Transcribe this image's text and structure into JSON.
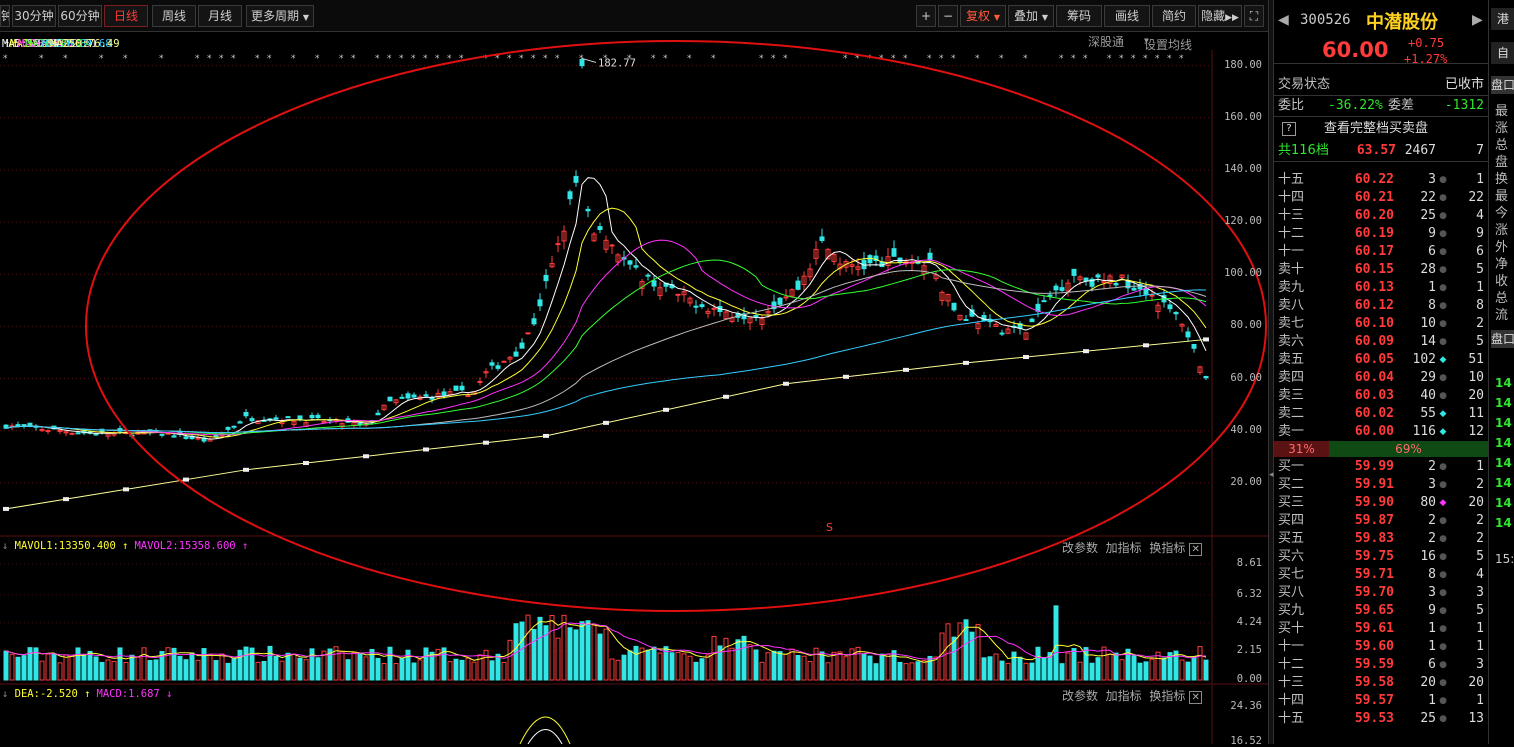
{
  "toolbar": {
    "left_partial": "钟",
    "periods": [
      "30分钟",
      "60分钟",
      "日线",
      "周线",
      "月线",
      "更多周期"
    ],
    "active_period": "日线",
    "zoom_in": "+",
    "zoom_out": "−",
    "right_buttons": [
      "复权",
      "叠加",
      "筹码",
      "画线",
      "简约",
      "隐藏"
    ],
    "expand_icon": "⛶"
  },
  "ma_legend": [
    {
      "text": "MA5:59.84",
      "arrow": "↑",
      "color": "#ffffff"
    },
    {
      "text": "MA10:59.68",
      "arrow": "↑",
      "color": "#ffff33"
    },
    {
      "text": "MA20:59.26",
      "arrow": "↑",
      "color": "#ff33ff"
    },
    {
      "text": "MA30:59.07",
      "arrow": "↑",
      "color": "#33ff33"
    },
    {
      "text": "MA60:72.51",
      "arrow": "↓",
      "color": "#cccccc"
    },
    {
      "text": "MA120:84.68",
      "arrow": "↓",
      "color": "#33ccff"
    },
    {
      "text": "MA250:76.49",
      "arrow": "↑",
      "color": "#ffff88"
    }
  ],
  "chart_links": {
    "shengutong": "深股通",
    "set_ma": "设置均线"
  },
  "peak_label": "182.77",
  "s_marker": "S",
  "price_axis": [
    "180.00",
    "160.00",
    "140.00",
    "120.00",
    "100.00",
    "80.00",
    "60.00",
    "40.00",
    "20.00"
  ],
  "volume_panel": {
    "legend": [
      {
        "text": "MAVOL1:13350.400",
        "arrow": "↑",
        "color": "#ffff33"
      },
      {
        "text": "MAVOL2:15358.600",
        "arrow": "↑",
        "color": "#ff33ff"
      }
    ],
    "axis": [
      "8.61",
      "6.32",
      "4.24",
      "2.15",
      "0.00"
    ],
    "links": [
      "改参数",
      "加指标",
      "换指标"
    ]
  },
  "macd_panel": {
    "legend": [
      {
        "text": "DEA:-2.520",
        "arrow": "↑",
        "color": "#ffff33"
      },
      {
        "text": "MACD:1.687",
        "arrow": "↓",
        "color": "#ff33ff"
      }
    ],
    "axis": [
      "24.36",
      "16.52"
    ],
    "links": [
      "改参数",
      "加指标",
      "换指标"
    ]
  },
  "close_icon": "✕",
  "colors": {
    "up": "#ff3b3b",
    "down": "#2ee62e",
    "cyan": "#33e6e6",
    "ellipse": "#e01010"
  },
  "stock": {
    "code": "300526",
    "name": "中潜股份",
    "price": "60.00",
    "change": "+0.75",
    "change_pct": "+1.27%",
    "trade_status_label": "交易状态",
    "trade_status": "已收市",
    "weibi_label": "委比",
    "weibi": "-36.22%",
    "weicha_label": "委差",
    "weicha": "-1312",
    "help_icon": "?",
    "full_book": "查看完整档买卖盘",
    "total_label": "共116档",
    "total_price": "63.57",
    "total_vol": "2467",
    "total_cnt": "7",
    "sell_ratio": "31%",
    "buy_ratio": "69%"
  },
  "asks": [
    {
      "label": "十五",
      "price": "60.22",
      "vol": "3",
      "cnt": "1"
    },
    {
      "label": "十四",
      "price": "60.21",
      "vol": "22",
      "cnt": "22"
    },
    {
      "label": "十三",
      "price": "60.20",
      "vol": "25",
      "cnt": "4"
    },
    {
      "label": "十二",
      "price": "60.19",
      "vol": "9",
      "cnt": "9"
    },
    {
      "label": "十一",
      "price": "60.17",
      "vol": "6",
      "cnt": "6"
    },
    {
      "label": "卖十",
      "price": "60.15",
      "vol": "28",
      "cnt": "5"
    },
    {
      "label": "卖九",
      "price": "60.13",
      "vol": "1",
      "cnt": "1"
    },
    {
      "label": "卖八",
      "price": "60.12",
      "vol": "8",
      "cnt": "8"
    },
    {
      "label": "卖七",
      "price": "60.10",
      "vol": "10",
      "cnt": "2"
    },
    {
      "label": "卖六",
      "price": "60.09",
      "vol": "14",
      "cnt": "5"
    },
    {
      "label": "卖五",
      "price": "60.05",
      "vol": "102",
      "cnt": "51",
      "dot": "cyan"
    },
    {
      "label": "卖四",
      "price": "60.04",
      "vol": "29",
      "cnt": "10"
    },
    {
      "label": "卖三",
      "price": "60.03",
      "vol": "40",
      "cnt": "20"
    },
    {
      "label": "卖二",
      "price": "60.02",
      "vol": "55",
      "cnt": "11",
      "dot": "cyan"
    },
    {
      "label": "卖一",
      "price": "60.00",
      "vol": "116",
      "cnt": "12",
      "dot": "cyan"
    }
  ],
  "bids": [
    {
      "label": "买一",
      "price": "59.99",
      "vol": "2",
      "cnt": "1"
    },
    {
      "label": "买二",
      "price": "59.91",
      "vol": "3",
      "cnt": "2"
    },
    {
      "label": "买三",
      "price": "59.90",
      "vol": "80",
      "cnt": "20",
      "dot": "magenta"
    },
    {
      "label": "买四",
      "price": "59.87",
      "vol": "2",
      "cnt": "2"
    },
    {
      "label": "买五",
      "price": "59.83",
      "vol": "2",
      "cnt": "2"
    },
    {
      "label": "买六",
      "price": "59.75",
      "vol": "16",
      "cnt": "5"
    },
    {
      "label": "买七",
      "price": "59.71",
      "vol": "8",
      "cnt": "4"
    },
    {
      "label": "买八",
      "price": "59.70",
      "vol": "3",
      "cnt": "3"
    },
    {
      "label": "买九",
      "price": "59.65",
      "vol": "9",
      "cnt": "5"
    },
    {
      "label": "买十",
      "price": "59.61",
      "vol": "1",
      "cnt": "1"
    },
    {
      "label": "十一",
      "price": "59.60",
      "vol": "1",
      "cnt": "1"
    },
    {
      "label": "十二",
      "price": "59.59",
      "vol": "6",
      "cnt": "3"
    },
    {
      "label": "十三",
      "price": "59.58",
      "vol": "20",
      "cnt": "20"
    },
    {
      "label": "十四",
      "price": "59.57",
      "vol": "1",
      "cnt": "1"
    },
    {
      "label": "十五",
      "price": "59.53",
      "vol": "25",
      "cnt": "13"
    }
  ],
  "far_panel": {
    "tabs": [
      "港",
      "自"
    ],
    "section_label": "盘口",
    "items": [
      "最",
      "涨",
      "总",
      "盘",
      "换",
      "最",
      "今",
      "涨",
      "外",
      "净",
      "收",
      "总",
      "流"
    ],
    "section2_label": "盘口",
    "ticks": [
      "14",
      "14",
      "14",
      "14",
      "14",
      "14",
      "14",
      "14"
    ],
    "time_label": "15:"
  }
}
